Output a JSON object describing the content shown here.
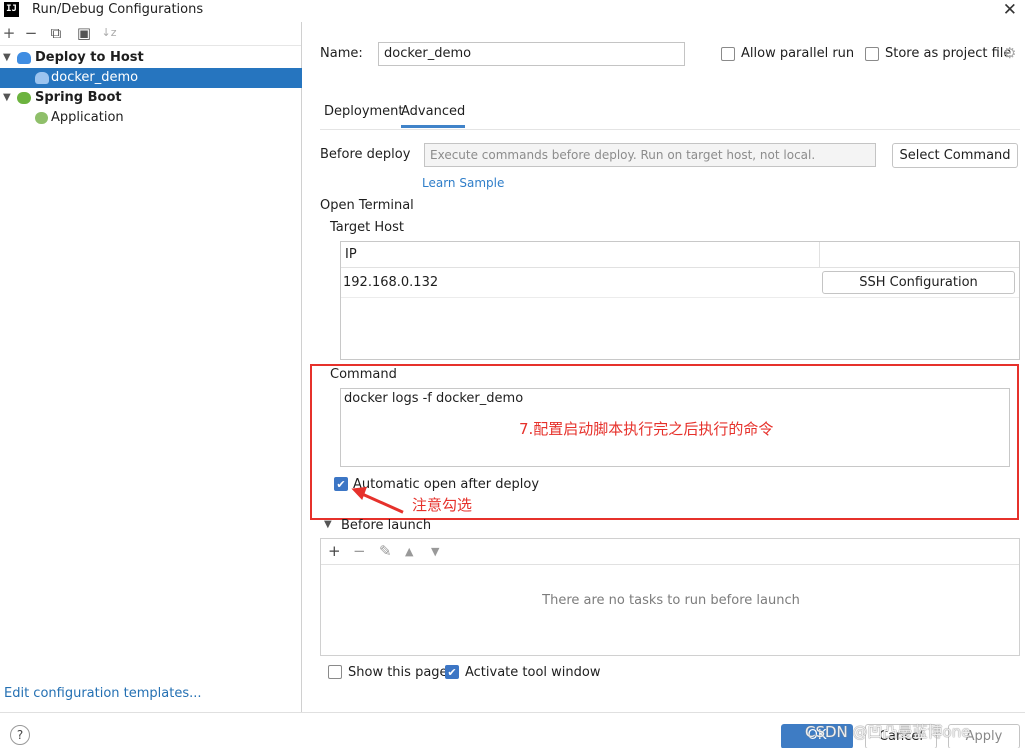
{
  "window": {
    "title": "Run/Debug Configurations",
    "logo_text": "IJ"
  },
  "sidebar": {
    "toolbar": [
      "+",
      "−",
      "⧉",
      "▣",
      "↓z"
    ],
    "tree": [
      {
        "label": "Deploy to Host",
        "bold": true
      },
      {
        "label": "docker_demo",
        "selected": true
      },
      {
        "label": "Spring Boot",
        "bold": true
      },
      {
        "label": "Application"
      }
    ],
    "edit_templates": "Edit configuration templates..."
  },
  "form": {
    "name_label": "Name:",
    "name_value": "docker_demo",
    "allow_parallel": "Allow parallel run",
    "store_project": "Store as project file",
    "tabs": [
      "Deployment",
      "Advanced"
    ],
    "before_deploy_label": "Before deploy",
    "before_deploy_placeholder": "Execute commands before deploy. Run on target host, not local.",
    "select_command": "Select Command",
    "learn_sample": "Learn Sample",
    "open_terminal": "Open Terminal",
    "target_host": "Target Host",
    "table": {
      "header": "IP",
      "ip": "192.168.0.132",
      "ssh_button": "SSH Configuration"
    },
    "command_label": "Command",
    "command_value": "docker logs -f docker_demo",
    "annotation_command": "7.配置启动脚本执行完之后执行的命令",
    "auto_open": "Automatic open after deploy",
    "annotation_check": "注意勾选",
    "before_launch": "Before launch",
    "no_tasks": "There are no tasks to run before launch",
    "show_page": "Show this page",
    "activate_tool": "Activate tool window"
  },
  "footer": {
    "help": "?",
    "ok": "OK",
    "cancel": "Cancel",
    "apply": "Apply",
    "watermark": "CSDN @凹凸曼蓝博one"
  }
}
